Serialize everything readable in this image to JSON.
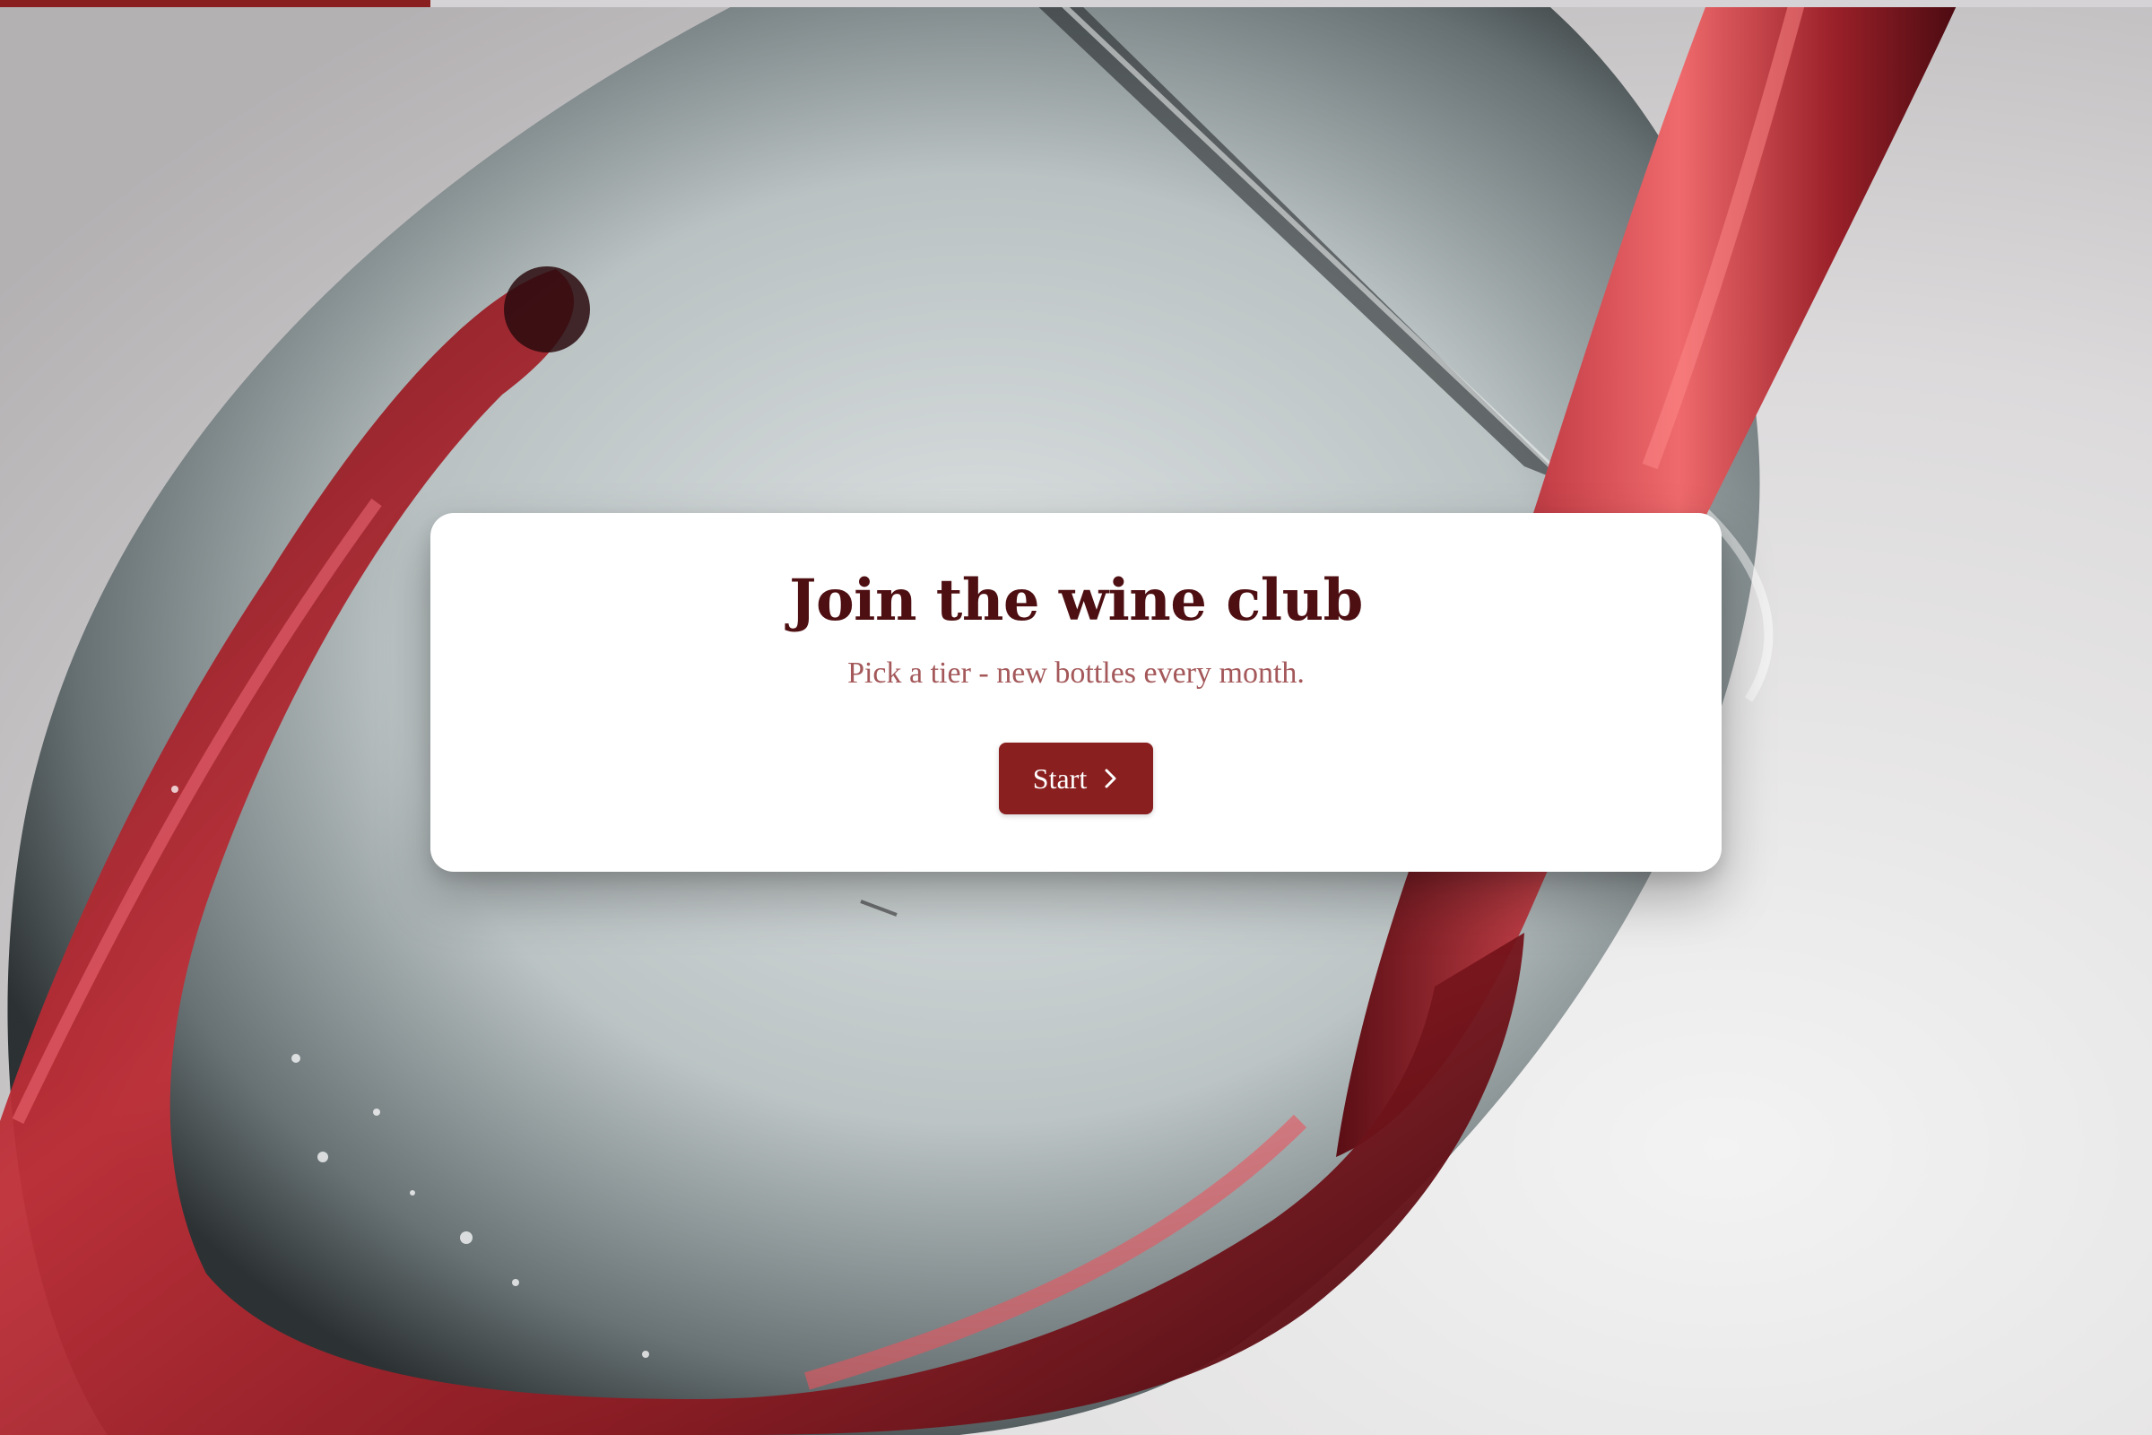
{
  "progress": {
    "percent": 20,
    "fill_color": "#8a1f1f",
    "track_color": "#d6d3d6"
  },
  "hero": {
    "image_subject": "red wine being poured into a tilted wine glass"
  },
  "card": {
    "title": "Join the wine club",
    "subtitle": "Pick a tier - new bottles every month.",
    "start_label": "Start",
    "start_icon": "chevron-right-icon"
  },
  "colors": {
    "title": "#4e0f12",
    "subtitle": "#a4585a",
    "button": "#8a1f1f",
    "wine": "#8f1a22"
  }
}
